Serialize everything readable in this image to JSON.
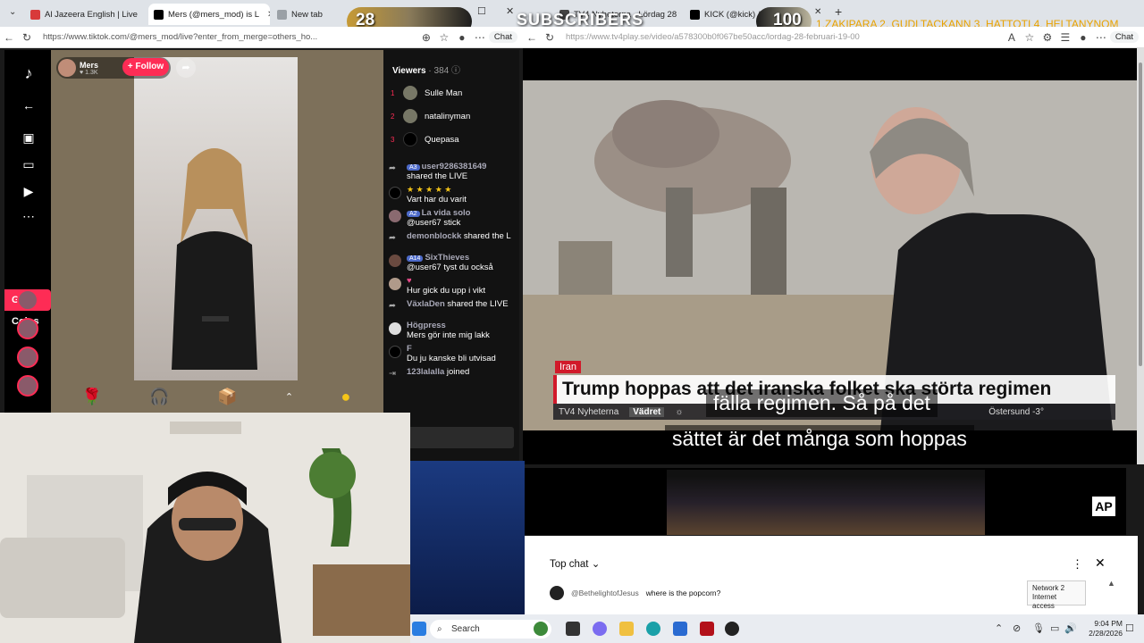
{
  "browser_left": {
    "tabs": [
      {
        "label": "Al Jazeera English | Live",
        "fav_color": "#d83a3a"
      },
      {
        "label": "Mers (@mers_mod) is L",
        "fav_color": "#000000"
      },
      {
        "label": "New tab",
        "fav_color": "#9aa0a6"
      }
    ],
    "url": "https://www.tiktok.com/@mers_mod/live?enter_from_merge=others_ho...",
    "chat_label": "Chat"
  },
  "browser_right": {
    "tabs": [
      {
        "label": "TV4 Nyheterna - Lördag 28 fe",
        "fav_color": "#444444"
      },
      {
        "label": "KICK (@kick) / X",
        "fav_color": "#000000"
      }
    ],
    "url": "https://www.tv4play.se/video/a578300b0f067be50acc/lordag-28-februari-19-00",
    "chat_label": "Chat"
  },
  "overlay": {
    "count_left": "28",
    "subscribers_label": "SUBSCRIBERS",
    "count_right": "100",
    "ticker": "1.ZAKIPARA 2. GUDLTACKANN  3. HATTOTI 4. HELTANYNOM"
  },
  "tiktok": {
    "host_name": "Mers",
    "host_likes": "♥ 1.3K",
    "follow_label": "+ Follow",
    "get_coins_label": "Get Coins",
    "viewers_label": "Viewers",
    "viewers_count": "· 384",
    "top_viewers": [
      {
        "rank": "1",
        "name": "Sulle Man"
      },
      {
        "rank": "2",
        "name": "natalinyman"
      },
      {
        "rank": "3",
        "name": "Quepasa"
      }
    ],
    "messages": [
      {
        "user": "user9286381649",
        "badge": "A3",
        "text": "shared the LIVE",
        "inline": false
      },
      {
        "user": "",
        "badge": "",
        "text": "Vart har du varit",
        "inline": false
      },
      {
        "user": "La vida solo",
        "badge": "A2",
        "text": "@user67 stick",
        "inline": false
      },
      {
        "user": "demonblockk",
        "badge": "",
        "text": "shared the L",
        "inline": true
      },
      {
        "user": "SixThieves",
        "badge": "A14",
        "text": "@user67 tyst du också",
        "inline": false
      },
      {
        "user": "",
        "badge": "",
        "text": "Hur gick du upp i vikt",
        "inline": false
      },
      {
        "user": "VäxlaDen",
        "badge": "",
        "text": "shared the LIVE",
        "inline": true
      },
      {
        "user": "Högpress",
        "badge": "",
        "text": "Mers gör inte mig lakk",
        "inline": false
      },
      {
        "user": "F",
        "badge": "",
        "text": "Du ju kanske bli utvisad",
        "inline": false
      },
      {
        "user": "123lalalla",
        "badge": "",
        "text": "joined",
        "inline": true
      }
    ],
    "stars": "★ ★ ★ ★ ★",
    "input_placeholder": "..."
  },
  "tv4": {
    "topic_tag": "Iran",
    "headline": "Trump hoppas att det iranska folket ska störta regimen",
    "program": "TV4 Nyheterna",
    "weather_label": "Vädret",
    "weather_city": "Östersund -3°",
    "caption_line1": "fälla regimen. Så på det",
    "caption_line2": "sättet är det många som hoppas"
  },
  "youtube": {
    "ap_logo": "AP",
    "top_chat_label": "Top chat",
    "comment_user": "@BethelightofJesus",
    "comment_text": "where is the popcorn?"
  },
  "tooltip": {
    "line1": "Network 2",
    "line2": "Internet access"
  },
  "taskbar": {
    "search_label": "Search",
    "time": "9:04 PM",
    "date": "2/28/2026"
  }
}
